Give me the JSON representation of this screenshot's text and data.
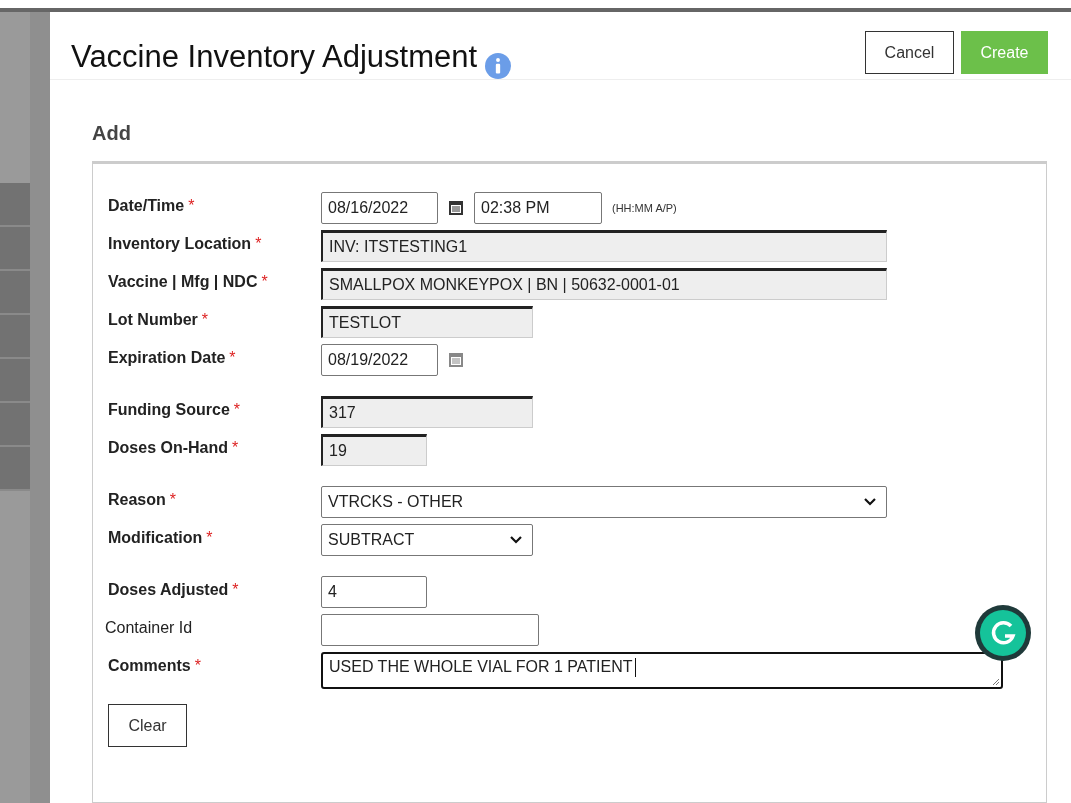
{
  "header": {
    "title": "Vaccine Inventory Adjustment",
    "buttons": [
      {
        "label": "Cancel",
        "kind": "secondary"
      },
      {
        "label": "Create",
        "kind": "primary"
      }
    ]
  },
  "section_title": "Add",
  "groups": [
    {
      "rows": [
        {
          "label": "Date/Time",
          "required_mark": "*",
          "fields": [
            {
              "kind": "date",
              "value": "08/16/2022",
              "disabled": false
            },
            {
              "kind": "time",
              "value": "02:38 PM",
              "hint": "(HH:MM A/P)"
            }
          ]
        },
        {
          "label": "Inventory Location",
          "required_mark": "*",
          "fields": [
            {
              "kind": "readonly",
              "value": "INV: ITSTESTING1"
            }
          ]
        },
        {
          "label": "Vaccine | Mfg | NDC",
          "required_mark": "*",
          "fields": [
            {
              "kind": "readonly",
              "value": "SMALLPOX MONKEYPOX    | BN    | 50632-0001-01"
            }
          ]
        },
        {
          "label": "Lot Number",
          "required_mark": "*",
          "fields": [
            {
              "kind": "readonly",
              "value": "TESTLOT"
            }
          ]
        },
        {
          "label": "Expiration Date",
          "required_mark": "*",
          "fields": [
            {
              "kind": "date",
              "value": "08/19/2022",
              "disabled": true
            }
          ]
        }
      ]
    },
    {
      "rows": [
        {
          "label": "Funding Source",
          "required_mark": "*",
          "fields": [
            {
              "kind": "readonly",
              "value": "317"
            }
          ]
        },
        {
          "label": "Doses On-Hand",
          "required_mark": "*",
          "fields": [
            {
              "kind": "readonly",
              "value": "19"
            }
          ]
        }
      ]
    },
    {
      "rows": [
        {
          "label": "Reason",
          "required_mark": "*",
          "fields": [
            {
              "kind": "select",
              "value": "VTRCKS - OTHER"
            }
          ]
        },
        {
          "label": "Modification",
          "required_mark": "*",
          "fields": [
            {
              "kind": "select",
              "value": "SUBTRACT"
            }
          ]
        }
      ]
    },
    {
      "rows": [
        {
          "label": "Doses Adjusted",
          "required_mark": "*",
          "fields": [
            {
              "kind": "text",
              "value": "4"
            }
          ]
        },
        {
          "label": "Container Id",
          "fields": [
            {
              "kind": "text"
            }
          ]
        },
        {
          "label": "Comments",
          "required_mark": "*",
          "fields": [
            {
              "kind": "textarea",
              "value": "USED THE WHOLE VIAL FOR 1 PATIENT"
            }
          ]
        }
      ]
    }
  ],
  "footer_buttons": [
    {
      "label": "Clear"
    }
  ]
}
